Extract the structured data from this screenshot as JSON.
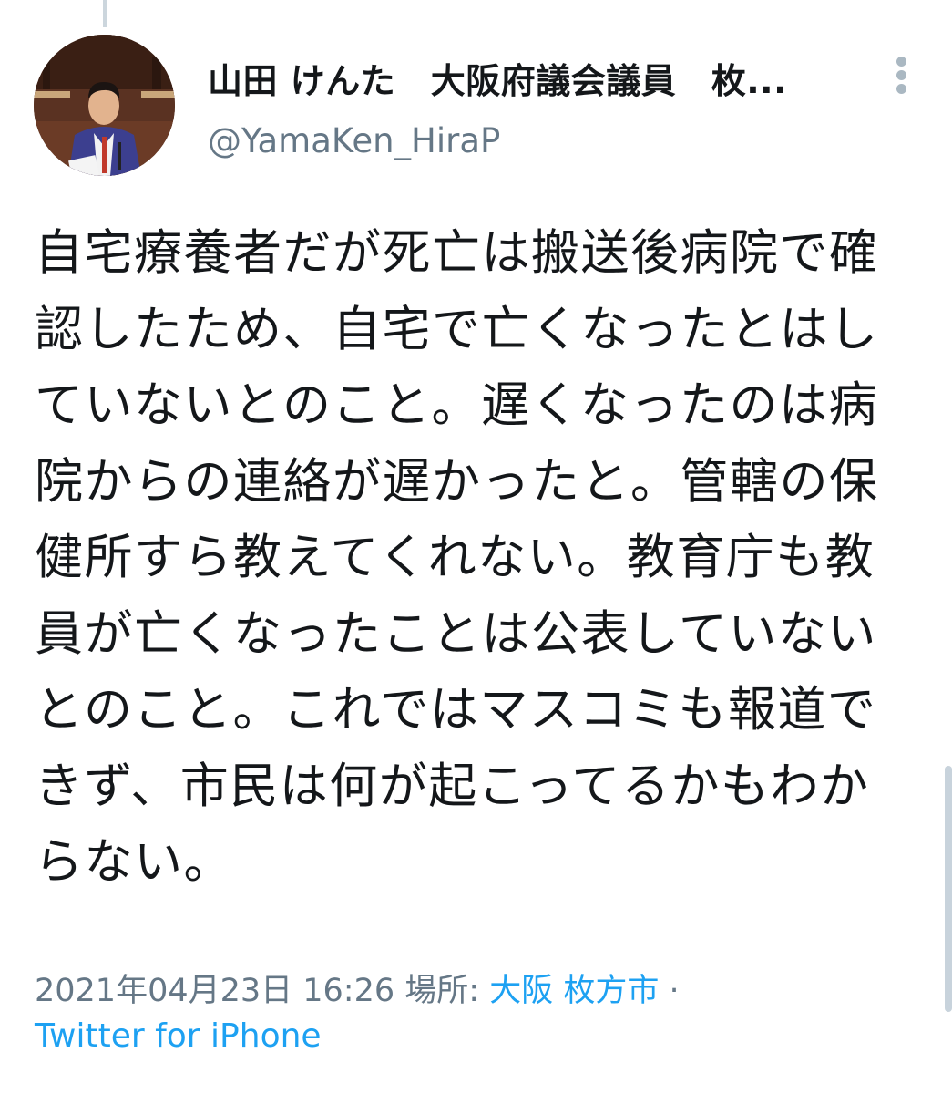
{
  "tweet": {
    "author": {
      "display_name": "山田 けんた　大阪府議会議員　枚...",
      "handle": "@YamaKen_HiraP"
    },
    "text": "自宅療養者だが死亡は搬送後病院で確認したため、自宅で亡くなったとはしていないとのこと。遅くなったのは病院からの連絡が遅かったと。管轄の保健所すら教えてくれない。教育庁も教員が亡くなったことは公表していないとのこと。これではマスコミも報道できず、市民は何が起こってるかもわからない。",
    "timestamp": "2021年04月23日 16:26",
    "location_label": "場所:",
    "location": "大阪 枚方市",
    "separator": "·",
    "source": "Twitter for iPhone"
  },
  "icons": {
    "more": "more-vertical-icon"
  },
  "colors": {
    "text": "#14171a",
    "secondary": "#657786",
    "link": "#1da1f2",
    "divider": "#ccd6dd"
  }
}
